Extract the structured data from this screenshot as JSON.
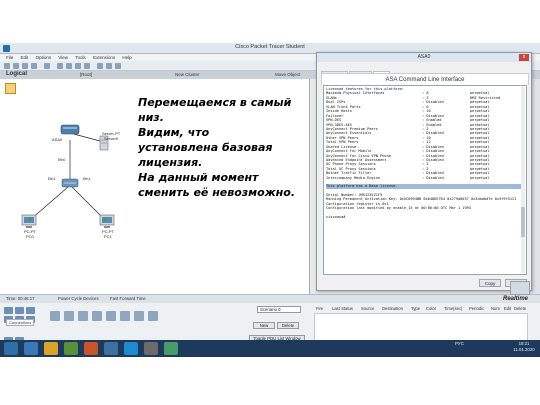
{
  "app": {
    "title": "Cisco Packet Tracer Student",
    "menu": [
      "File",
      "Edit",
      "Options",
      "View",
      "Tools",
      "Extensions",
      "Help"
    ]
  },
  "navbar": {
    "logical": "Logical",
    "root": "[Root]",
    "cluster": "New Cluster",
    "tile": "Move Object"
  },
  "network": {
    "server_label": "Server-PT",
    "server_label2": "Server0",
    "asa_label": "ASA0",
    "pc0_label": "PC-PT",
    "pc0_label2": "PC0",
    "pc1_label": "PC-PT",
    "pc1_label2": "PC1",
    "port_left": "Eth0",
    "port_mid": "Eth1",
    "port_right": "Eth1"
  },
  "overlay": {
    "lines": [
      "Перемещаемся в самый",
      "низ.",
      "Видим, что",
      "установлена базовая",
      "лицензия.",
      "На данный момент",
      "сменить её невозможно."
    ]
  },
  "dialog": {
    "title": "ASA0",
    "close": "x",
    "tabs": [
      "Physical",
      "Config",
      "CLI"
    ],
    "cli_title": "ASA Command Line Interface",
    "license_rows": [
      [
        "Licensed features for this platform:",
        "",
        ""
      ],
      [
        "Maximum Physical Interfaces",
        ": 8",
        "perpetual"
      ],
      [
        "VLANs",
        ": 3",
        "DMZ Restricted"
      ],
      [
        "Dual ISPs",
        ": Disabled",
        "perpetual"
      ],
      [
        "VLAN Trunk Ports",
        ": 0",
        "perpetual"
      ],
      [
        "Inside Hosts",
        ": 10",
        "perpetual"
      ],
      [
        "Failover",
        ": Disabled",
        "perpetual"
      ],
      [
        "VPN-DES",
        ": Enabled",
        "perpetual"
      ],
      [
        "VPN-3DES-AES",
        ": Enabled",
        "perpetual"
      ],
      [
        "AnyConnect Premium Peers",
        ": 2",
        "perpetual"
      ],
      [
        "AnyConnect Essentials",
        ": Disabled",
        "perpetual"
      ],
      [
        "Other VPN Peers",
        ": 10",
        "perpetual"
      ],
      [
        "Total VPN Peers",
        ": 12",
        "perpetual"
      ],
      [
        "Shared License",
        ": Disabled",
        "perpetual"
      ],
      [
        "AnyConnect for Mobile",
        ": Disabled",
        "perpetual"
      ],
      [
        "AnyConnect for Cisco VPN Phone",
        ": Disabled",
        "perpetual"
      ],
      [
        "Advanced Endpoint Assessment",
        ": Disabled",
        "perpetual"
      ],
      [
        "UC Phone Proxy Sessions",
        ": 2",
        "perpetual"
      ],
      [
        "Total UC Proxy Sessions",
        ": 2",
        "perpetual"
      ],
      [
        "Botnet Traffic Filter",
        ": Disabled",
        "perpetual"
      ],
      [
        "Intercompany Media Engine",
        ": Disabled",
        "perpetual"
      ]
    ],
    "highlight_line": "This platform has a Base license.",
    "tail_lines": [
      "Serial Number: JMX1235Z1F9",
      "Running Permanent Activation Key: 0x5C6994BB 0x64D6E7D4 0x279d8037 0x3dadbd7e 0x9f9f5121",
      "Configuration register is 0x1",
      "Configuration last modified by enable_15 at 00:00:00 UTC Mar 1 1993",
      "",
      "ciscoasa#"
    ],
    "copy_btn": "Copy",
    "paste_btn": "Paste"
  },
  "bottom": {
    "time": "Time: 00:46:17",
    "power": "Power Cycle Devices",
    "fastfwd": "Fast Forward Time",
    "realtime": "Realtime",
    "connections": "Connections",
    "scenario": "Scenario 0",
    "new_btn": "New",
    "delete_btn": "Delete",
    "toggle_btn": "Toggle PDU List Window",
    "pdu_headers": [
      "Fire",
      "Last Status",
      "Source",
      "Destination",
      "Type",
      "Color",
      "Time(sec)",
      "Periodic",
      "Num",
      "Edit",
      "Delete"
    ]
  },
  "taskbar": {
    "lang": "РУС",
    "time": "19:21",
    "date": "11.01.2020"
  },
  "colors": {
    "overlay_text": "#000000",
    "highlight": "#9fb9d6",
    "taskbar": "#1d3a5c"
  }
}
